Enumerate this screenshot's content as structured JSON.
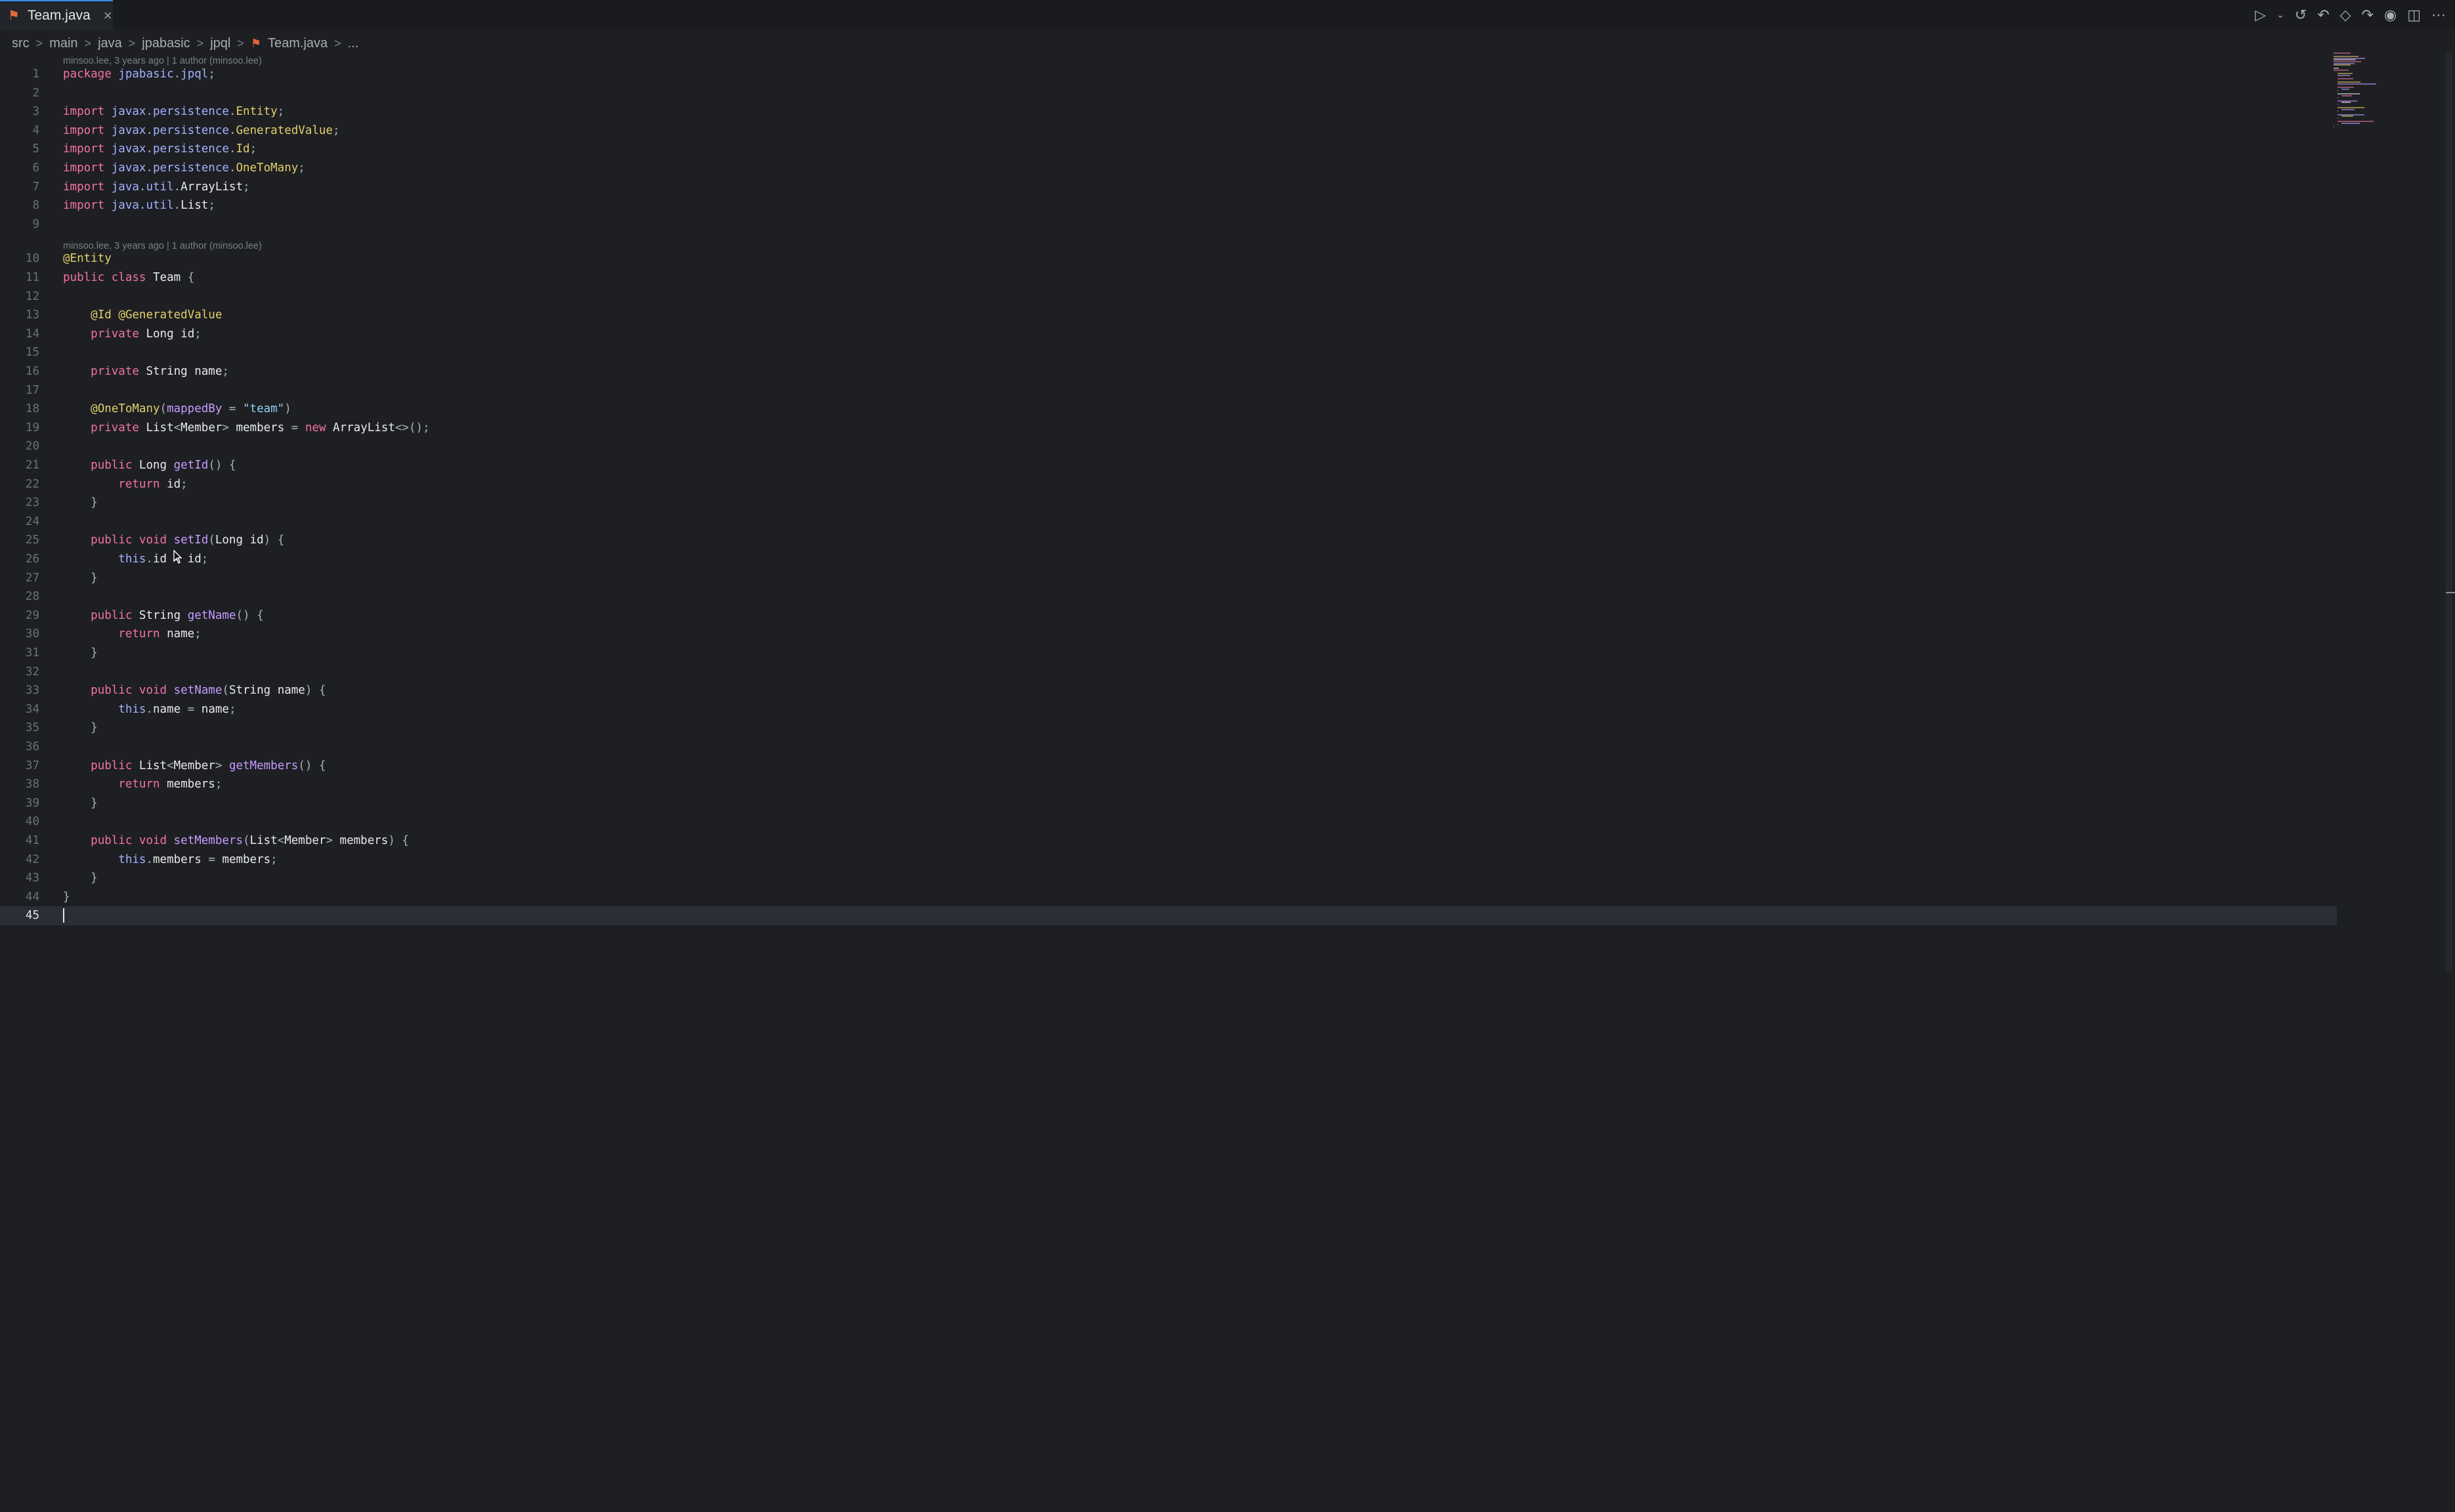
{
  "tab": {
    "name": "Team.java",
    "close": "×"
  },
  "breadcrumbs": [
    "src",
    "main",
    "java",
    "jpabasic",
    "jpql",
    "Team.java",
    "..."
  ],
  "actions": [
    "run-icon",
    "history-icon",
    "go-back-icon",
    "changes-icon",
    "go-forward-icon",
    "copilot-icon",
    "split-editor-icon",
    "more-icon"
  ],
  "blame": [
    "minsoo.lee, 3 years ago | 1 author (minsoo.lee)",
    "minsoo.lee, 3 years ago | 1 author (minsoo.lee)"
  ],
  "lines": [
    {
      "n": "1",
      "code": "package jpabasic.jpql;"
    },
    {
      "n": "2",
      "code": ""
    },
    {
      "n": "3",
      "code": "import javax.persistence.Entity;"
    },
    {
      "n": "4",
      "code": "import javax.persistence.GeneratedValue;"
    },
    {
      "n": "5",
      "code": "import javax.persistence.Id;"
    },
    {
      "n": "6",
      "code": "import javax.persistence.OneToMany;"
    },
    {
      "n": "7",
      "code": "import java.util.ArrayList;"
    },
    {
      "n": "8",
      "code": "import java.util.List;"
    },
    {
      "n": "9",
      "code": ""
    },
    {
      "n": "10",
      "code": "@Entity"
    },
    {
      "n": "11",
      "code": "public class Team {"
    },
    {
      "n": "12",
      "code": ""
    },
    {
      "n": "13",
      "code": "    @Id @GeneratedValue"
    },
    {
      "n": "14",
      "code": "    private Long id;"
    },
    {
      "n": "15",
      "code": ""
    },
    {
      "n": "16",
      "code": "    private String name;"
    },
    {
      "n": "17",
      "code": ""
    },
    {
      "n": "18",
      "code": "    @OneToMany(mappedBy = \"team\")"
    },
    {
      "n": "19",
      "code": "    private List<Member> members = new ArrayList<>();"
    },
    {
      "n": "20",
      "code": ""
    },
    {
      "n": "21",
      "code": "    public Long getId() {"
    },
    {
      "n": "22",
      "code": "        return id;"
    },
    {
      "n": "23",
      "code": "    }"
    },
    {
      "n": "24",
      "code": ""
    },
    {
      "n": "25",
      "code": "    public void setId(Long id) {"
    },
    {
      "n": "26",
      "code": "        this.id = id;"
    },
    {
      "n": "27",
      "code": "    }"
    },
    {
      "n": "28",
      "code": ""
    },
    {
      "n": "29",
      "code": "    public String getName() {"
    },
    {
      "n": "30",
      "code": "        return name;"
    },
    {
      "n": "31",
      "code": "    }"
    },
    {
      "n": "32",
      "code": ""
    },
    {
      "n": "33",
      "code": "    public void setName(String name) {"
    },
    {
      "n": "34",
      "code": "        this.name = name;"
    },
    {
      "n": "35",
      "code": "    }"
    },
    {
      "n": "36",
      "code": ""
    },
    {
      "n": "37",
      "code": "    public List<Member> getMembers() {"
    },
    {
      "n": "38",
      "code": "        return members;"
    },
    {
      "n": "39",
      "code": "    }"
    },
    {
      "n": "40",
      "code": ""
    },
    {
      "n": "41",
      "code": "    public void setMembers(List<Member> members) {"
    },
    {
      "n": "42",
      "code": "        this.members = members;"
    },
    {
      "n": "43",
      "code": "    }"
    },
    {
      "n": "44",
      "code": "}"
    },
    {
      "n": "45",
      "code": ""
    }
  ]
}
